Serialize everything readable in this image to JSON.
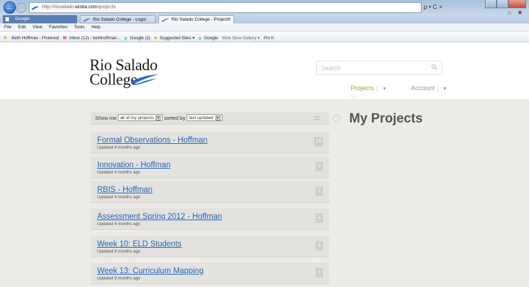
{
  "browser": {
    "address_prefix": "http://riosalado.",
    "address_domain": "wistia.com",
    "address_path": "/projects",
    "address_tools": "ρ • C ×",
    "tabs": [
      {
        "label": "Google"
      },
      {
        "label": "Rio Salado College - Login"
      },
      {
        "label": "Rio Salado College - Projects"
      }
    ],
    "tab_close": "×",
    "menu": [
      "File",
      "Edit",
      "View",
      "Favorites",
      "Tools",
      "Help"
    ],
    "favorites": [
      "Beth Hoffman - Pinterest",
      "Inbox (12) - bethhoffman...",
      "Google (2)",
      "Suggested Sites ▾",
      "Google",
      "Web Slice Gallery ▾",
      "Pin It"
    ]
  },
  "site": {
    "logo_line1": "Rio Salado",
    "logo_line2": "College",
    "search_placeholder": "Search",
    "nav": {
      "projects": "Projects",
      "account": "Account"
    }
  },
  "filter": {
    "show_me": "Show me",
    "scope": "all of my projects",
    "sorted_by": "sorted by",
    "sort": "last updated"
  },
  "page_title": "My Projects",
  "projects": [
    {
      "name": "Formal Observations - Hoffman",
      "updated": "Updated 4 months ago",
      "count": "25"
    },
    {
      "name": "Innovation - Hoffman",
      "updated": "Updated 4 months ago",
      "count": "2"
    },
    {
      "name": "RBIS - Hoffman",
      "updated": "Updated 4 months ago",
      "count": "2"
    },
    {
      "name": "Assessment Spring 2012 - Hoffman",
      "updated": "Updated 4 months ago",
      "count": "4"
    },
    {
      "name": "Week 10: ELD Students",
      "updated": "Updated 9 months ago",
      "count": "1"
    },
    {
      "name": "Week 13: Curriculum Mapping",
      "updated": "Updated 9 months ago",
      "count": "3"
    }
  ],
  "colors": {
    "link": "#2266bb",
    "accent": "#8db33b",
    "background": "#ecebe7"
  }
}
